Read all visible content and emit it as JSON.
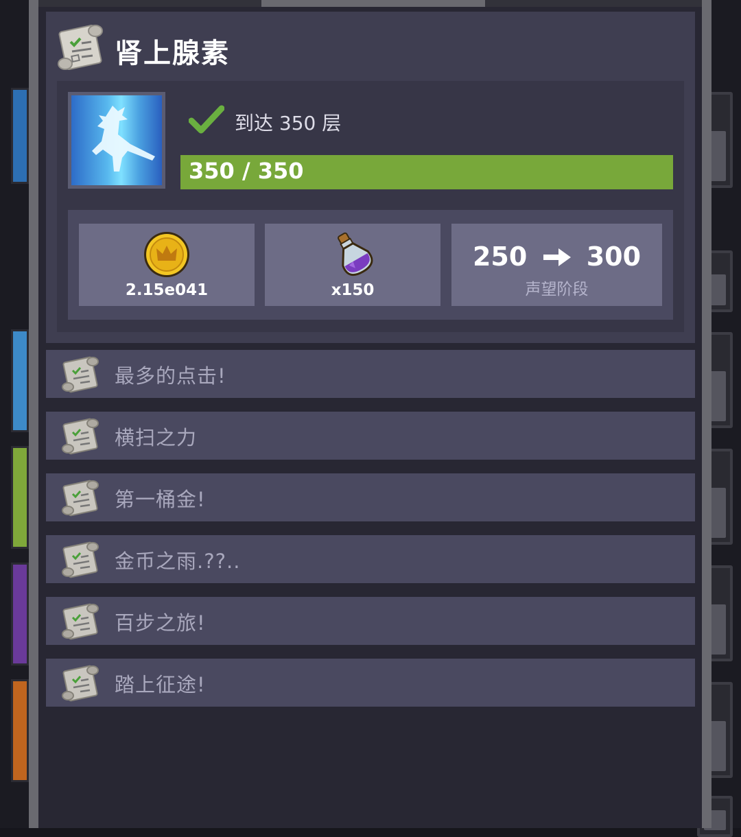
{
  "achievement": {
    "title": "肾上腺素",
    "goal_text": "到达 350 层",
    "progress_text": "350 / 350",
    "progress_fraction": 1.0,
    "rewards": [
      {
        "icon": "gold-coin-icon",
        "label": "2.15e041"
      },
      {
        "icon": "potion-icon",
        "label": "x150"
      },
      {
        "icon": "arrow-right-icon",
        "from": "250",
        "to": "300",
        "label": "声望阶段"
      }
    ]
  },
  "other_achievements": [
    {
      "label": "最多的点击!"
    },
    {
      "label": "横扫之力"
    },
    {
      "label": "第一桶金!"
    },
    {
      "label": "金币之雨.??.."
    },
    {
      "label": "百步之旅!"
    },
    {
      "label": "踏上征途!"
    }
  ],
  "colors": {
    "progress": "#78a83a",
    "check": "#6ab040",
    "panel": "#3f3e51",
    "row": "#4a4960"
  }
}
